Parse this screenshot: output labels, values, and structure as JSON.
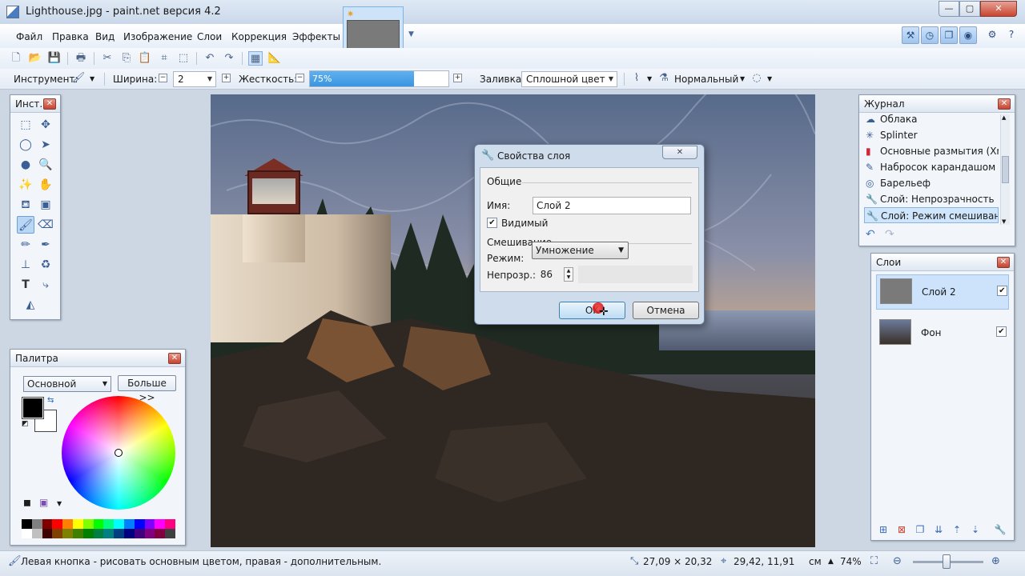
{
  "window": {
    "title": "Lighthouse.jpg - paint.net версия 4.2"
  },
  "menu": {
    "items": [
      "Файл",
      "Правка",
      "Вид",
      "Изображение",
      "Слои",
      "Коррекция",
      "Эффекты"
    ]
  },
  "toolbar2": {
    "tool_label": "Инструмент:",
    "width_label": "Ширина:",
    "width_value": "2",
    "hardness_label": "Жесткость:",
    "hardness_value": "75%",
    "hardness_level": 0.75,
    "fill_label": "Заливка:",
    "fill_value": "Сплошной цвет",
    "blend_value": "Нормальный"
  },
  "tools_panel": {
    "title": "Инст..."
  },
  "palette": {
    "title": "Палитра",
    "mode_value": "Основной",
    "more_label": "Больше >>",
    "colors": [
      "#000000",
      "#808080",
      "#800000",
      "#ff0000",
      "#ff8000",
      "#ffff00",
      "#80ff00",
      "#00ff00",
      "#00ff80",
      "#00ffff",
      "#0080ff",
      "#0000ff",
      "#8000ff",
      "#ff00ff",
      "#ff0080",
      "#ffffff",
      "#c0c0c0",
      "#400000",
      "#804000",
      "#808000",
      "#408000",
      "#008000",
      "#008040",
      "#008080",
      "#004080",
      "#000080",
      "#400080",
      "#800080",
      "#800040",
      "#404040"
    ]
  },
  "journal": {
    "title": "Журнал",
    "items": [
      {
        "label": "Облака",
        "icon": "clouds-icon"
      },
      {
        "label": "Splinter",
        "icon": "splinter-icon"
      },
      {
        "label": "Основные размытия (Xmario)",
        "icon": "blur-icon"
      },
      {
        "label": "Набросок карандашом",
        "icon": "pencil-sketch-icon"
      },
      {
        "label": "Барельеф",
        "icon": "emboss-icon"
      },
      {
        "label": "Слой: Непрозрачность",
        "icon": "wrench-icon"
      },
      {
        "label": "Слой: Режим смешивания",
        "icon": "wrench-icon"
      }
    ]
  },
  "layers": {
    "title": "Слои",
    "items": [
      {
        "name": "Слой 2",
        "visible": true
      },
      {
        "name": "Фон",
        "visible": true
      }
    ]
  },
  "dialog": {
    "title": "Свойства слоя",
    "general_section": "Общие",
    "name_label": "Имя:",
    "name_value": "Слой 2",
    "visible_label": "Видимый",
    "blending_section": "Смешивание",
    "mode_label": "Режим:",
    "mode_value": "Умножение",
    "opacity_label": "Непрозр.:",
    "opacity_value": "86",
    "ok_label": "OK",
    "cancel_label": "Отмена"
  },
  "status": {
    "hint": "Левая кнопка - рисовать основным цветом, правая - дополнительным.",
    "size": "27,09 × 20,32",
    "cursor_pos": "29,42, 11,91",
    "units": "см",
    "zoom": "74%"
  }
}
